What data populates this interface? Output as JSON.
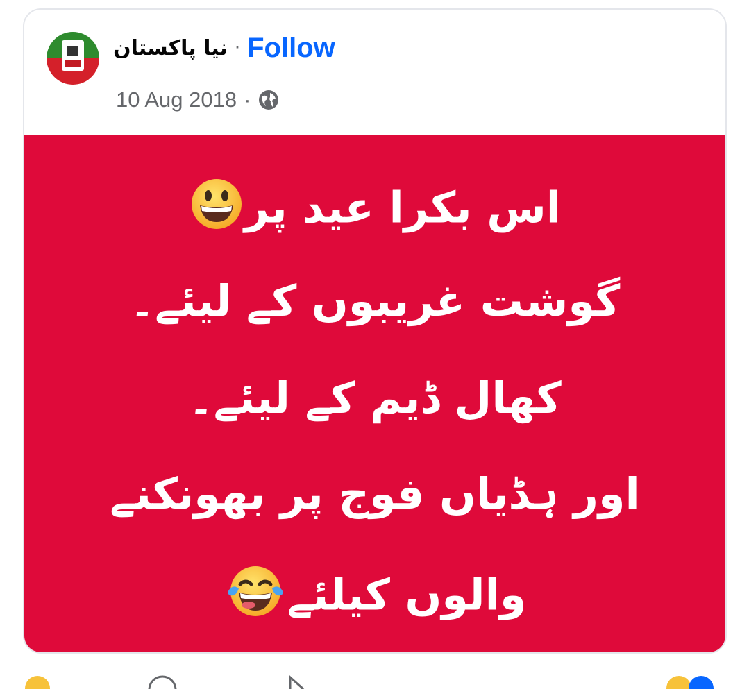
{
  "post": {
    "page_name": "نیا پاکستان",
    "separator": "·",
    "follow_label": "Follow",
    "date": "10 Aug 2018",
    "meta_separator": "·",
    "audience_icon": "globe-icon",
    "image": {
      "background_color": "#df0a3a",
      "text_color": "#ffffff",
      "lines": [
        "اس  بکرا عید پر",
        "گوشت غریبوں کے لیئے۔",
        "کھال ڈیم کے لیئے۔",
        "اور ہڈیاں فوج پر بھونکنے",
        "والوں کیلئے"
      ],
      "emojis": [
        "grinning-face-emoji",
        "tears-of-joy-emoji"
      ]
    }
  },
  "footer": {
    "reactions_icon": "reaction-emoji-icon",
    "comment_icon": "comment-icon",
    "share_icon": "share-icon"
  }
}
